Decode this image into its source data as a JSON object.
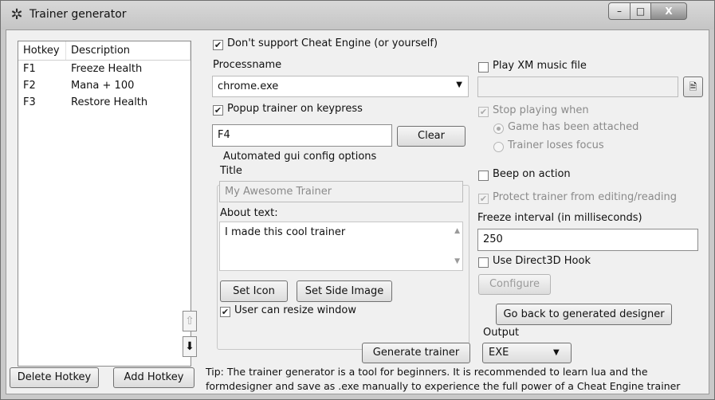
{
  "window": {
    "title": "Trainer generator",
    "controls": {
      "minimize": "–",
      "maximize": "□",
      "close": "X"
    }
  },
  "hotkeys": {
    "columns": [
      "Hotkey",
      "Description"
    ],
    "rows": [
      {
        "key": "F1",
        "desc": "Freeze Health"
      },
      {
        "key": "F2",
        "desc": "Mana + 100"
      },
      {
        "key": "F3",
        "desc": "Restore Health"
      }
    ],
    "up_icon": "up-arrow-icon",
    "down_icon": "down-arrow-icon",
    "delete_label": "Delete Hotkey",
    "add_label": "Add Hotkey"
  },
  "settings": {
    "no_cheat_engine_label": "Don't support Cheat Engine (or yourself)",
    "processname_label": "Processname",
    "processname_value": "chrome.exe",
    "popup_label": "Popup trainer on keypress",
    "popup_key_value": "F4",
    "clear_label": "Clear",
    "group_title": "Automated gui config options",
    "title_label": "Title",
    "title_value": "My Awesome Trainer",
    "about_label": "About text:",
    "about_value": "I made this cool trainer",
    "set_icon_label": "Set Icon",
    "set_side_image_label": "Set Side Image",
    "resize_label": "User can resize window",
    "generate_label": "Generate trainer"
  },
  "right": {
    "play_xm_label": "Play XM music file",
    "stop_playing_label": "Stop playing when",
    "radio_attached": "Game has been attached",
    "radio_focus": "Trainer loses focus",
    "beep_label": "Beep on action",
    "protect_label": "Protect trainer from editing/reading",
    "freeze_label": "Freeze interval (in milliseconds)",
    "freeze_value": "250",
    "d3d_label": "Use Direct3D Hook",
    "configure_label": "Configure",
    "go_back_label": "Go back to generated designer",
    "output_label": "Output",
    "output_value": "EXE"
  },
  "tip": {
    "line1": "Tip: The trainer generator is a tool for beginners. It is recommended to learn lua and the",
    "line2": "formdesigner and save as .exe manually to experience the full power of a Cheat Engine trainer"
  }
}
